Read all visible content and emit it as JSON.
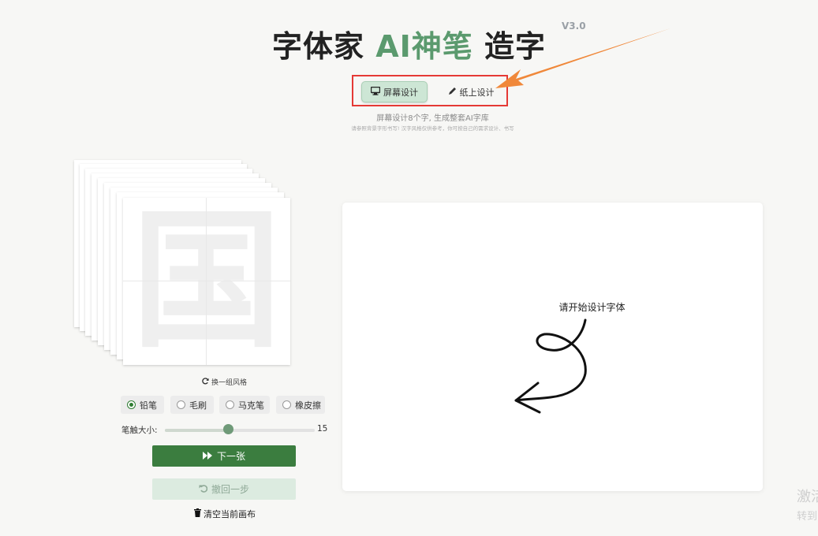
{
  "header": {
    "title_part1": "字体家 ",
    "title_ai": "AI神笔",
    "title_part2": " 造字",
    "version": "V3.0"
  },
  "mode": {
    "screen_label": "屏幕设计",
    "paper_label": "纸上设计",
    "active": "screen"
  },
  "hints": {
    "line1": "屏幕设计8个字, 生成整套AI字库",
    "line2": "请参照背景字形书写! 汉字风格仅供参考，你可按自己的需求设计、书写"
  },
  "reference": {
    "glyph": "国",
    "switch_style_label": "换一组风格"
  },
  "tools": {
    "items": [
      {
        "label": "铅笔",
        "selected": true
      },
      {
        "label": "毛刷",
        "selected": false
      },
      {
        "label": "马克笔",
        "selected": false
      },
      {
        "label": "橡皮擦",
        "selected": false
      }
    ]
  },
  "brush": {
    "label": "笔触大小:",
    "value": "15",
    "fraction": 0.42
  },
  "actions": {
    "next_label": "下一张",
    "undo_label": "撤回一步",
    "clear_label": "清空当前画布"
  },
  "canvas": {
    "hint": "请开始设计字体"
  },
  "watermark": {
    "line1": "激活",
    "line2": "转到"
  },
  "colors": {
    "accent": "#3b7d3f",
    "ai_green": "#5b9a6e",
    "highlight_box": "#e53935",
    "arrow": "#f0883a"
  }
}
